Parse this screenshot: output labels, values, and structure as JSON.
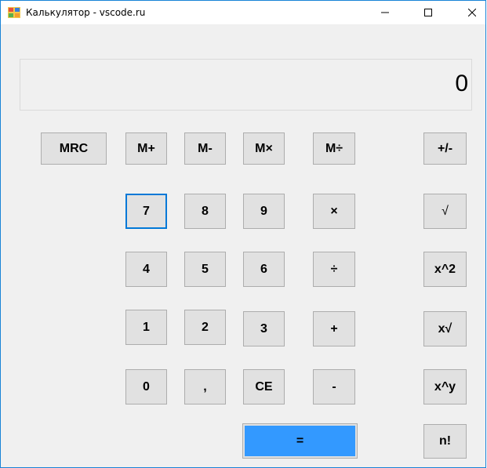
{
  "window": {
    "title": "Калькулятор - vscode.ru",
    "controls": [
      "minimize-icon",
      "maximize-icon",
      "close-icon"
    ]
  },
  "display": {
    "value": "0"
  },
  "buttons": {
    "mrc": "MRC",
    "m_plus": "M+",
    "m_minus": "M-",
    "m_mul": "M×",
    "m_div": "M÷",
    "plus_minus": "+/-",
    "d7": "7",
    "d8": "8",
    "d9": "9",
    "multiply": "×",
    "sqrt": "√",
    "d4": "4",
    "d5": "5",
    "d6": "6",
    "divide": "÷",
    "square": "x^2",
    "d1": "1",
    "d2": "2",
    "d3": "3",
    "plus": "+",
    "xroot": "x√",
    "d0": "0",
    "comma": ",",
    "ce": "CE",
    "minus": "-",
    "power": "x^y",
    "equals": "=",
    "factorial": "n!"
  },
  "colors": {
    "accent": "#3399ff",
    "focus_border": "#0078d7",
    "button_bg": "#e1e1e1",
    "window_bg": "#f0f0f0"
  }
}
